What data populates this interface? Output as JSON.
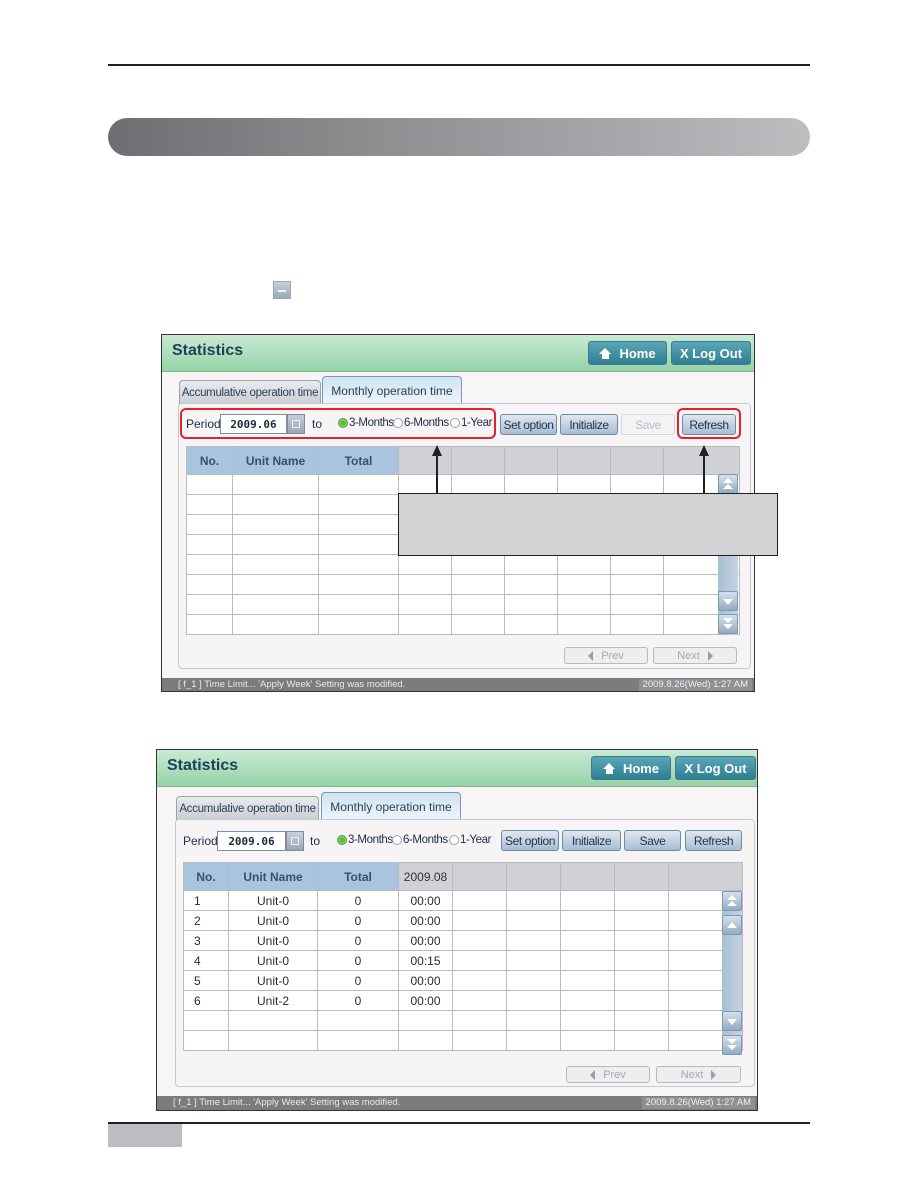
{
  "document": {
    "inline_icon": "calendar-button-icon"
  },
  "screen1": {
    "title": "Statistics",
    "home_label": "Home",
    "logout_label": "X Log Out",
    "tabs": [
      {
        "label": "Accumulative operation time",
        "active": false
      },
      {
        "label": "Monthly operation time",
        "active": true
      }
    ],
    "period_label": "Period",
    "date_value": "2009.06",
    "to_label": "to",
    "radios": [
      {
        "label": "3-Months",
        "checked": true
      },
      {
        "label": "6-Months",
        "checked": false
      },
      {
        "label": "1-Year",
        "checked": false
      }
    ],
    "buttons": {
      "set_option": "Set option",
      "initialize": "Initialize",
      "save": "Save",
      "refresh": "Refresh"
    },
    "save_enabled": false,
    "columns": [
      "No.",
      "Unit Name",
      "Total",
      "",
      "",
      "",
      "",
      "",
      ""
    ],
    "rows": [],
    "empty_rows": 8,
    "prev_label": "Prev",
    "next_label": "Next",
    "status_message": "[ f_1 ] Time Limit... 'Apply Week' Setting was modified.",
    "status_time": "2009.8.26(Wed)  1:27 AM",
    "highlight_color": "#e0242b"
  },
  "screen2": {
    "title": "Statistics",
    "home_label": "Home",
    "logout_label": "X Log Out",
    "tabs": [
      {
        "label": "Accumulative operation time",
        "active": false
      },
      {
        "label": "Monthly operation time",
        "active": true
      }
    ],
    "period_label": "Period",
    "date_value": "2009.06",
    "to_label": "to",
    "radios": [
      {
        "label": "3-Months",
        "checked": true
      },
      {
        "label": "6-Months",
        "checked": false
      },
      {
        "label": "1-Year",
        "checked": false
      }
    ],
    "buttons": {
      "set_option": "Set option",
      "initialize": "Initialize",
      "save": "Save",
      "refresh": "Refresh"
    },
    "save_enabled": true,
    "columns": [
      "No.",
      "Unit Name",
      "Total",
      "2009.08",
      "",
      "",
      "",
      "",
      ""
    ],
    "rows": [
      [
        "1",
        "Unit-0",
        "0",
        "00:00"
      ],
      [
        "2",
        "Unit-0",
        "0",
        "00:00"
      ],
      [
        "3",
        "Unit-0",
        "0",
        "00:00"
      ],
      [
        "4",
        "Unit-0",
        "0",
        "00:15"
      ],
      [
        "5",
        "Unit-0",
        "0",
        "00:00"
      ],
      [
        "6",
        "Unit-2",
        "0",
        "00:00"
      ]
    ],
    "empty_rows": 2,
    "prev_label": "Prev",
    "next_label": "Next",
    "status_message": "[ f_1 ] Time Limit... 'Apply Week' Setting was modified.",
    "status_time": "2009.8.26(Wed)  1:27 AM"
  }
}
